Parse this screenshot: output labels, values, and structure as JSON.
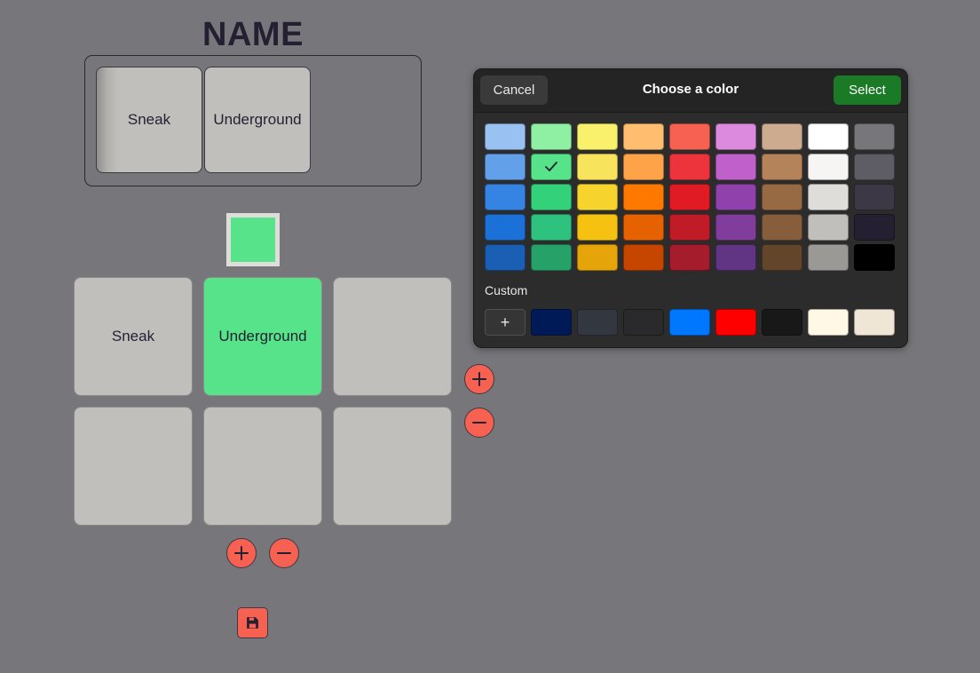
{
  "title": "NAME",
  "tray": {
    "tiles": [
      "Sneak",
      "Underground"
    ]
  },
  "selected_swatch": "#57e389",
  "grid": {
    "tiles": [
      {
        "label": "Sneak",
        "color": "#c0bfbc"
      },
      {
        "label": "Underground",
        "color": "#57e389"
      },
      {
        "label": "",
        "color": "#c0bfbc"
      },
      {
        "label": "",
        "color": "#c0bfbc"
      },
      {
        "label": "",
        "color": "#c0bfbc"
      },
      {
        "label": "",
        "color": "#c0bfbc"
      }
    ]
  },
  "controls": {
    "add_column_icon": "plus-icon",
    "remove_column_icon": "minus-icon",
    "add_row_icon": "plus-icon",
    "remove_row_icon": "minus-icon",
    "save_icon": "floppy-disk-icon"
  },
  "dialog": {
    "cancel_label": "Cancel",
    "title": "Choose a color",
    "select_label": "Select",
    "palette_columns": [
      [
        "#99c1f1",
        "#62a0ea",
        "#3584e4",
        "#1c71d8",
        "#1a5fb4"
      ],
      [
        "#8ff0a4",
        "#57e389",
        "#33d17a",
        "#2ec27e",
        "#26a269"
      ],
      [
        "#f9f06b",
        "#f8e45c",
        "#f6d32d",
        "#f5c211",
        "#e5a50a"
      ],
      [
        "#ffbe6f",
        "#ffa348",
        "#ff7800",
        "#e66100",
        "#c64600"
      ],
      [
        "#f66151",
        "#ed333b",
        "#e01b24",
        "#c01c28",
        "#a51d2d"
      ],
      [
        "#dc8add",
        "#c061cb",
        "#9141ac",
        "#813d9c",
        "#613583"
      ],
      [
        "#cdab8f",
        "#b5835a",
        "#986a44",
        "#865e3c",
        "#63452c"
      ],
      [
        "#ffffff",
        "#f6f5f4",
        "#deddda",
        "#c0bfbc",
        "#9a9996"
      ],
      [
        "#77767b",
        "#5e5c64",
        "#3d3846",
        "#241f31",
        "#000000"
      ]
    ],
    "selected_color": "#57e389",
    "custom_label": "Custom",
    "custom_add_label": "+",
    "custom_colors": [
      "#001a57",
      "#333840",
      "#2a2a2c",
      "#0077ff",
      "#ff0000",
      "#181818",
      "#fff8e6",
      "#f0e6d6"
    ]
  }
}
